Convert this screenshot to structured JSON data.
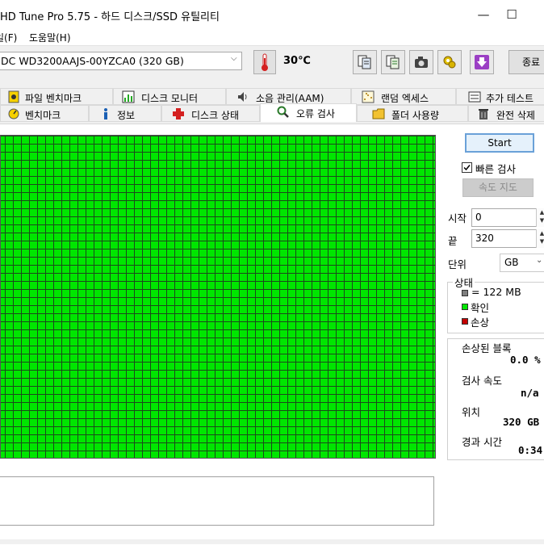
{
  "window": {
    "title": "HD Tune Pro 5.75 - 하드 디스크/SSD 유틸리티",
    "minimize_glyph": "—",
    "maximize_glyph": "☐"
  },
  "menu": {
    "items": [
      {
        "label": "일(F)"
      },
      {
        "label": "도움말(H)"
      }
    ]
  },
  "toolbar": {
    "drive": "DC WD3200AAJS-00YZCA0 (320 GB)",
    "temperature": "30℃",
    "exit_label": "종료",
    "icons": [
      "copy-info-icon",
      "copy-text-icon",
      "screenshot-icon",
      "options-icon",
      "save-icon"
    ]
  },
  "tabs": {
    "row1": [
      {
        "label": "파일 벤치마크",
        "icon": "file-benchmark-icon"
      },
      {
        "label": "디스크 모니터",
        "icon": "disk-monitor-icon"
      },
      {
        "label": "소음 관리(AAM)",
        "icon": "speaker-icon"
      },
      {
        "label": "랜덤 엑세스",
        "icon": "random-access-icon"
      },
      {
        "label": "추가 테스트",
        "icon": "extra-tests-icon"
      }
    ],
    "row2": [
      {
        "label": "벤치마크",
        "icon": "benchmark-icon"
      },
      {
        "label": "정보",
        "icon": "info-icon"
      },
      {
        "label": "디스크 상태",
        "icon": "health-icon"
      },
      {
        "label": "오류 검사",
        "icon": "magnifier-icon",
        "active": true
      },
      {
        "label": "폴더 사용량",
        "icon": "folder-icon"
      },
      {
        "label": "완전 삭제",
        "icon": "trash-icon"
      }
    ]
  },
  "controls": {
    "start_label": "Start",
    "quick_scan_label": "빠른 검사",
    "quick_scan_checked": true,
    "speed_map_label": "속도 지도",
    "start_field_label": "시작",
    "start_value": "0",
    "end_field_label": "끝",
    "end_value": "320",
    "unit_label": "단위",
    "unit_value": "GB"
  },
  "status": {
    "title": "상태",
    "legend": [
      {
        "label": "= 122 MB",
        "color": "#7f7f7f"
      },
      {
        "label": "확인",
        "color": "#00e600"
      },
      {
        "label": "손상",
        "color": "#c40000"
      }
    ]
  },
  "stats": {
    "damaged_label": "손상된 블록",
    "damaged_value": "0.0 %",
    "speed_label": "검사 속도",
    "speed_value": "n/a",
    "position_label": "위치",
    "position_value": "320 GB",
    "elapsed_label": "경과 시간",
    "elapsed_value": "0:34"
  },
  "colors": {
    "ok_block": "#00e600",
    "grid_line": "#1b4a1b",
    "damaged": "#c40000"
  }
}
